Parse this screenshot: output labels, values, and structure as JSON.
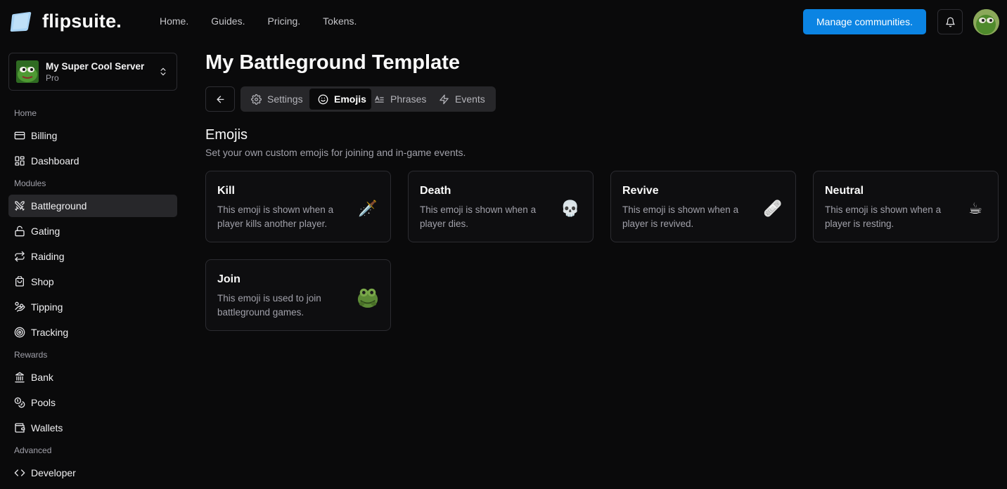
{
  "brand": {
    "name": "flipsuite."
  },
  "nav": {
    "items": [
      "Home.",
      "Guides.",
      "Pricing.",
      "Tokens."
    ]
  },
  "header": {
    "manage_label": "Manage communities."
  },
  "server": {
    "name": "My Super Cool Server",
    "plan": "Pro"
  },
  "sidebar": {
    "sections": [
      {
        "title": "Home",
        "items": [
          {
            "label": "Billing",
            "icon": "card-icon"
          },
          {
            "label": "Dashboard",
            "icon": "dashboard-icon"
          }
        ]
      },
      {
        "title": "Modules",
        "items": [
          {
            "label": "Battleground",
            "icon": "swords-icon",
            "active": true
          },
          {
            "label": "Gating",
            "icon": "lock-icon"
          },
          {
            "label": "Raiding",
            "icon": "repeat-icon"
          },
          {
            "label": "Shop",
            "icon": "shopping-bag-icon"
          },
          {
            "label": "Tipping",
            "icon": "hand-coins-icon"
          },
          {
            "label": "Tracking",
            "icon": "target-icon"
          }
        ]
      },
      {
        "title": "Rewards",
        "items": [
          {
            "label": "Bank",
            "icon": "bank-icon"
          },
          {
            "label": "Pools",
            "icon": "coins-icon"
          },
          {
            "label": "Wallets",
            "icon": "wallet-icon"
          }
        ]
      },
      {
        "title": "Advanced",
        "items": [
          {
            "label": "Developer",
            "icon": "code-icon"
          }
        ]
      }
    ]
  },
  "page": {
    "title": "My Battleground Template"
  },
  "tabs": [
    {
      "label": "Settings",
      "icon": "gear-icon"
    },
    {
      "label": "Emojis",
      "icon": "smile-icon",
      "active": true
    },
    {
      "label": "Phrases",
      "icon": "text-icon"
    },
    {
      "label": "Events",
      "icon": "zap-icon"
    }
  ],
  "section": {
    "title": "Emojis",
    "subtitle": "Set your own custom emojis for joining and in-game events."
  },
  "cards": [
    {
      "title": "Kill",
      "description": "This emoji is shown when a player kills another player.",
      "emoji": "🗡️"
    },
    {
      "title": "Death",
      "description": "This emoji is shown when a player dies.",
      "emoji": "💀"
    },
    {
      "title": "Revive",
      "description": "This emoji is shown when a player is revived.",
      "emoji": "🩹"
    },
    {
      "title": "Neutral",
      "description": "This emoji is shown when a player is resting.",
      "emoji": "☕"
    },
    {
      "title": "Join",
      "description": "This emoji is used to join battleground games.",
      "emoji": "frog-emoji"
    }
  ],
  "colors": {
    "accent": "#0b84e3",
    "background": "#0a0a0b",
    "card_border": "#2c2c31"
  }
}
